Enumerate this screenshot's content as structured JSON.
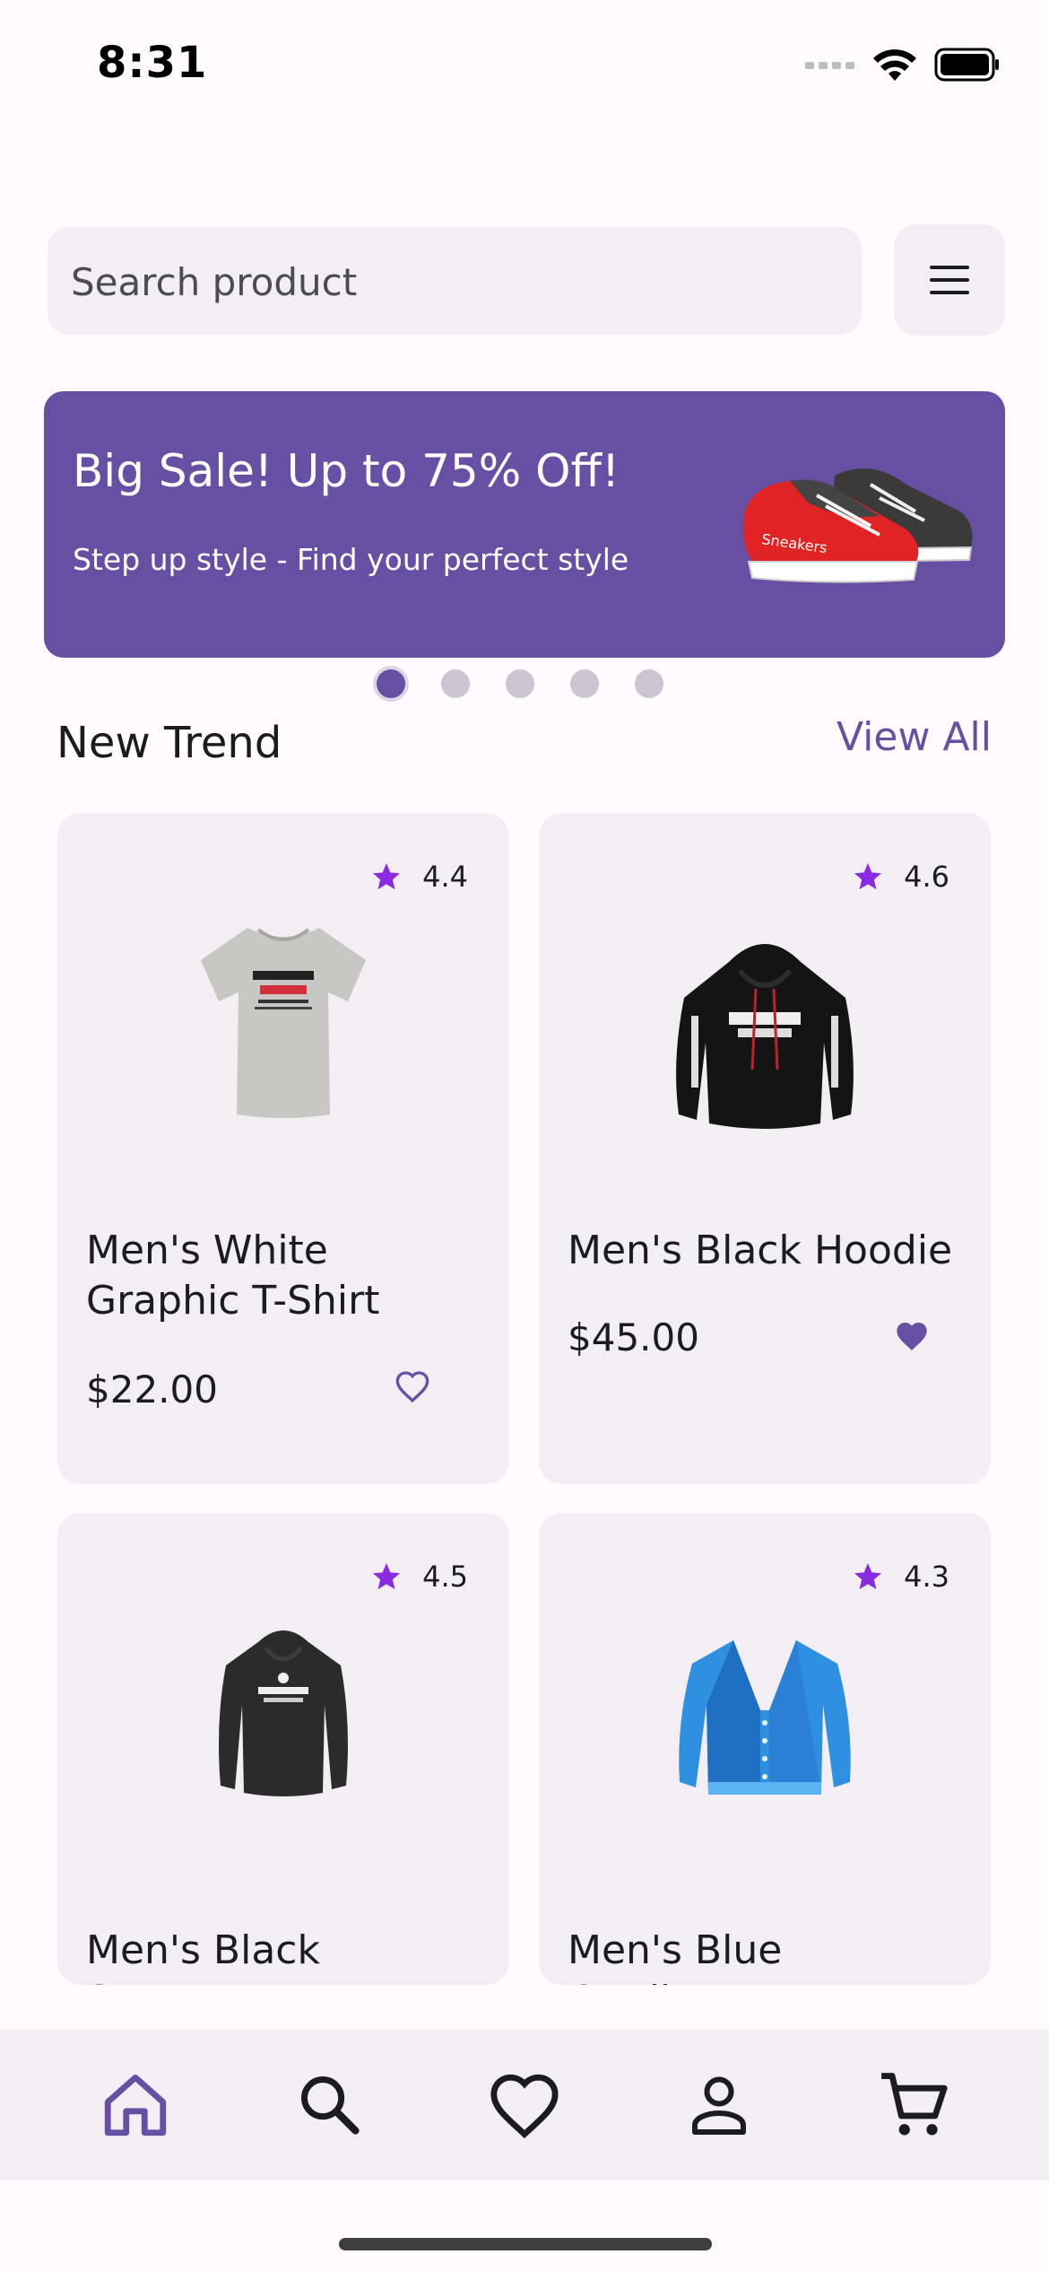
{
  "status_bar": {
    "time": "8:31"
  },
  "search": {
    "placeholder": "Search product",
    "value": ""
  },
  "banner": {
    "title": "Big Sale! Up to 75% Off!",
    "subtitle": "Step up style - Find your perfect style",
    "image_label": "Sneakers"
  },
  "carousel": {
    "count": 5,
    "active_index": 0
  },
  "section": {
    "title": "New Trend",
    "view_all": "View All"
  },
  "products": [
    {
      "name": "Men's White Graphic T-Shirt",
      "rating": "4.4",
      "price": "$22.00",
      "favorite": false,
      "image_icon": "tshirt-icon"
    },
    {
      "name": "Men's Black Hoodie",
      "rating": "4.6",
      "price": "$45.00",
      "favorite": true,
      "image_icon": "hoodie-icon"
    },
    {
      "name": "Men's Black Sweater",
      "rating": "4.5",
      "price": "",
      "favorite": false,
      "image_icon": "sweater-icon"
    },
    {
      "name": "Men's Blue Cardigan",
      "rating": "4.3",
      "price": "",
      "favorite": false,
      "image_icon": "cardigan-icon"
    }
  ],
  "bottom_nav": [
    {
      "name": "home",
      "icon": "home-icon",
      "active": true
    },
    {
      "name": "search",
      "icon": "search-icon",
      "active": false
    },
    {
      "name": "favorites",
      "icon": "heart-icon",
      "active": false
    },
    {
      "name": "profile",
      "icon": "person-icon",
      "active": false
    },
    {
      "name": "cart",
      "icon": "cart-icon",
      "active": false
    }
  ],
  "colors": {
    "primary": "#6750a4",
    "surface": "#f2eef4",
    "star": "#8a2be2",
    "background": "#fffbfe"
  }
}
